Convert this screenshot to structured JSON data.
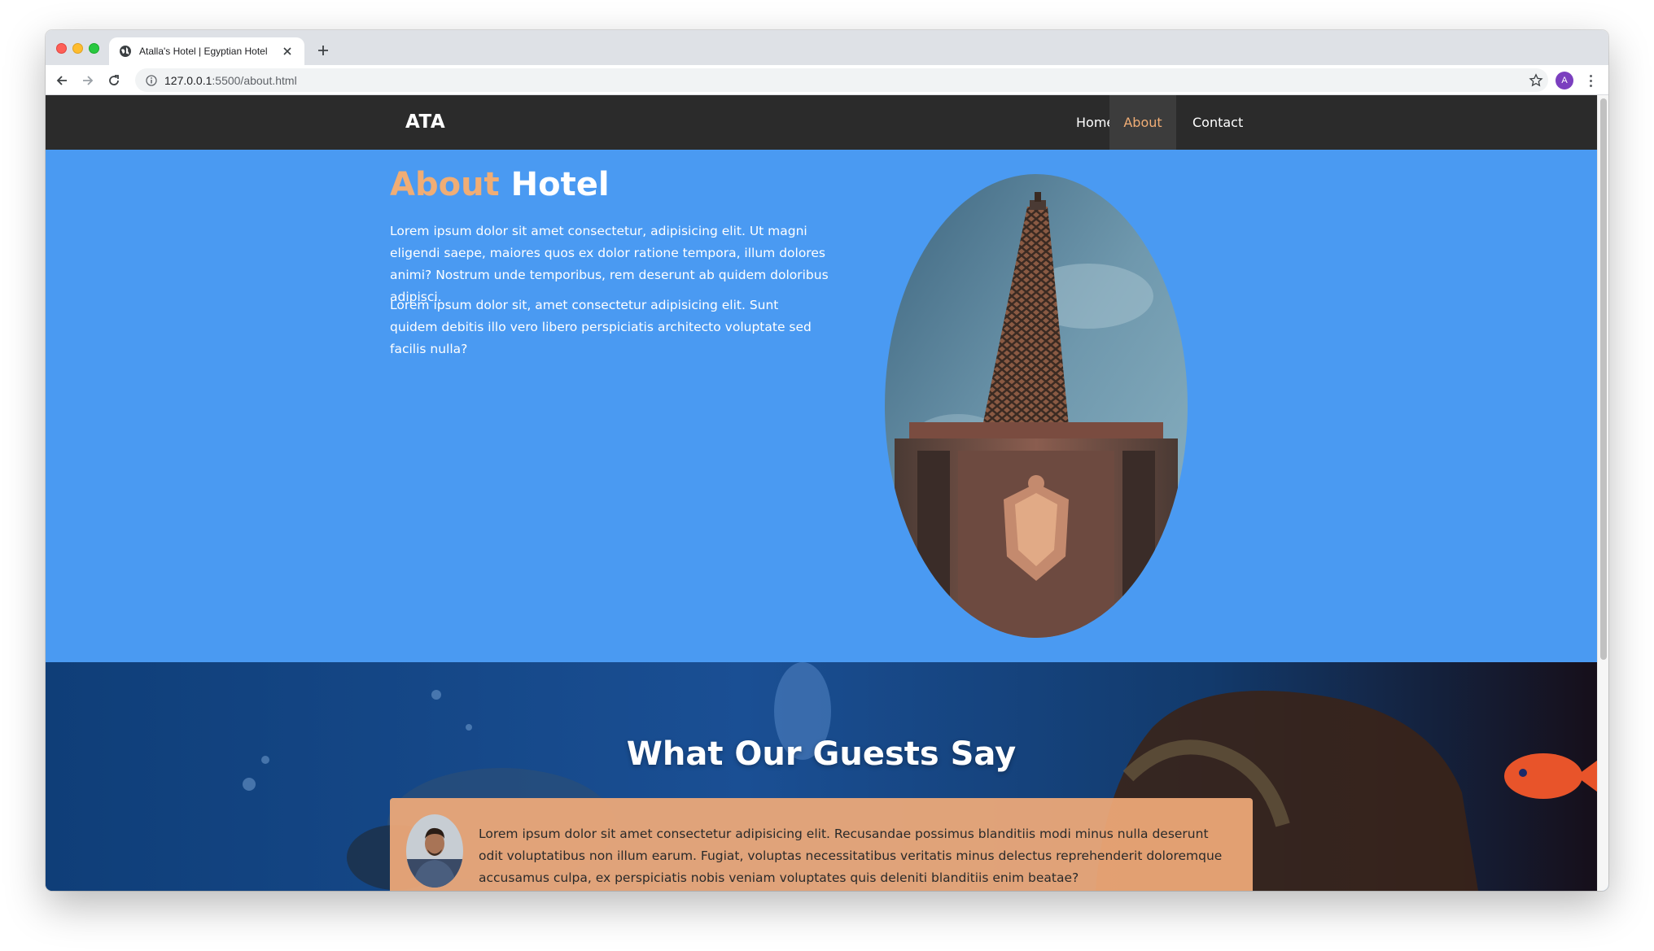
{
  "browser": {
    "tab_title": "Atalla's Hotel | Egyptian Hotel",
    "url_host": "127.0.0.1",
    "url_path": ":5500/about.html",
    "profile_initial": "A",
    "icons": {
      "back": "arrow-back-icon",
      "forward": "arrow-forward-icon",
      "reload": "reload-icon",
      "info": "info-icon",
      "bookmark": "star-icon",
      "menu": "kebab-menu-icon",
      "new_tab": "plus-icon",
      "close_tab": "close-icon"
    }
  },
  "site": {
    "logo": "ATA",
    "nav": [
      {
        "label": "Home"
      },
      {
        "label": "About",
        "active": true
      },
      {
        "label": "Contact"
      }
    ]
  },
  "about": {
    "title_accent": "About",
    "title_rest": "Hotel",
    "paragraphs": [
      "Lorem ipsum dolor sit amet consectetur, adipisicing elit. Ut magni eligendi saepe, maiores quos ex dolor ratione tempora, illum dolores animi? Nostrum unde temporibus, rem deserunt ab quidem doloribus adipisci.",
      "Lorem ipsum dolor sit, amet consectetur adipisicing elit. Sunt quidem debitis illo vero libero perspiciatis architecto voluptate sed facilis nulla?"
    ]
  },
  "guests": {
    "title": "What Our Guests Say",
    "testimonial": "Lorem ipsum dolor sit amet consectetur adipisicing elit. Recusandae possimus blanditiis modi minus nulla deserunt odit voluptatibus non illum earum. Fugiat, voluptas necessitatibus veritatis minus delectus reprehenderit doloremque accusamus culpa, ex perspiciatis nobis veniam voluptates quis deleniti blanditiis enim beatae?"
  },
  "colors": {
    "nav_bg": "#2b2b2b",
    "accent": "#f0ad75",
    "about_bg": "#4a9af2",
    "card_bg": "#f0aa78"
  }
}
